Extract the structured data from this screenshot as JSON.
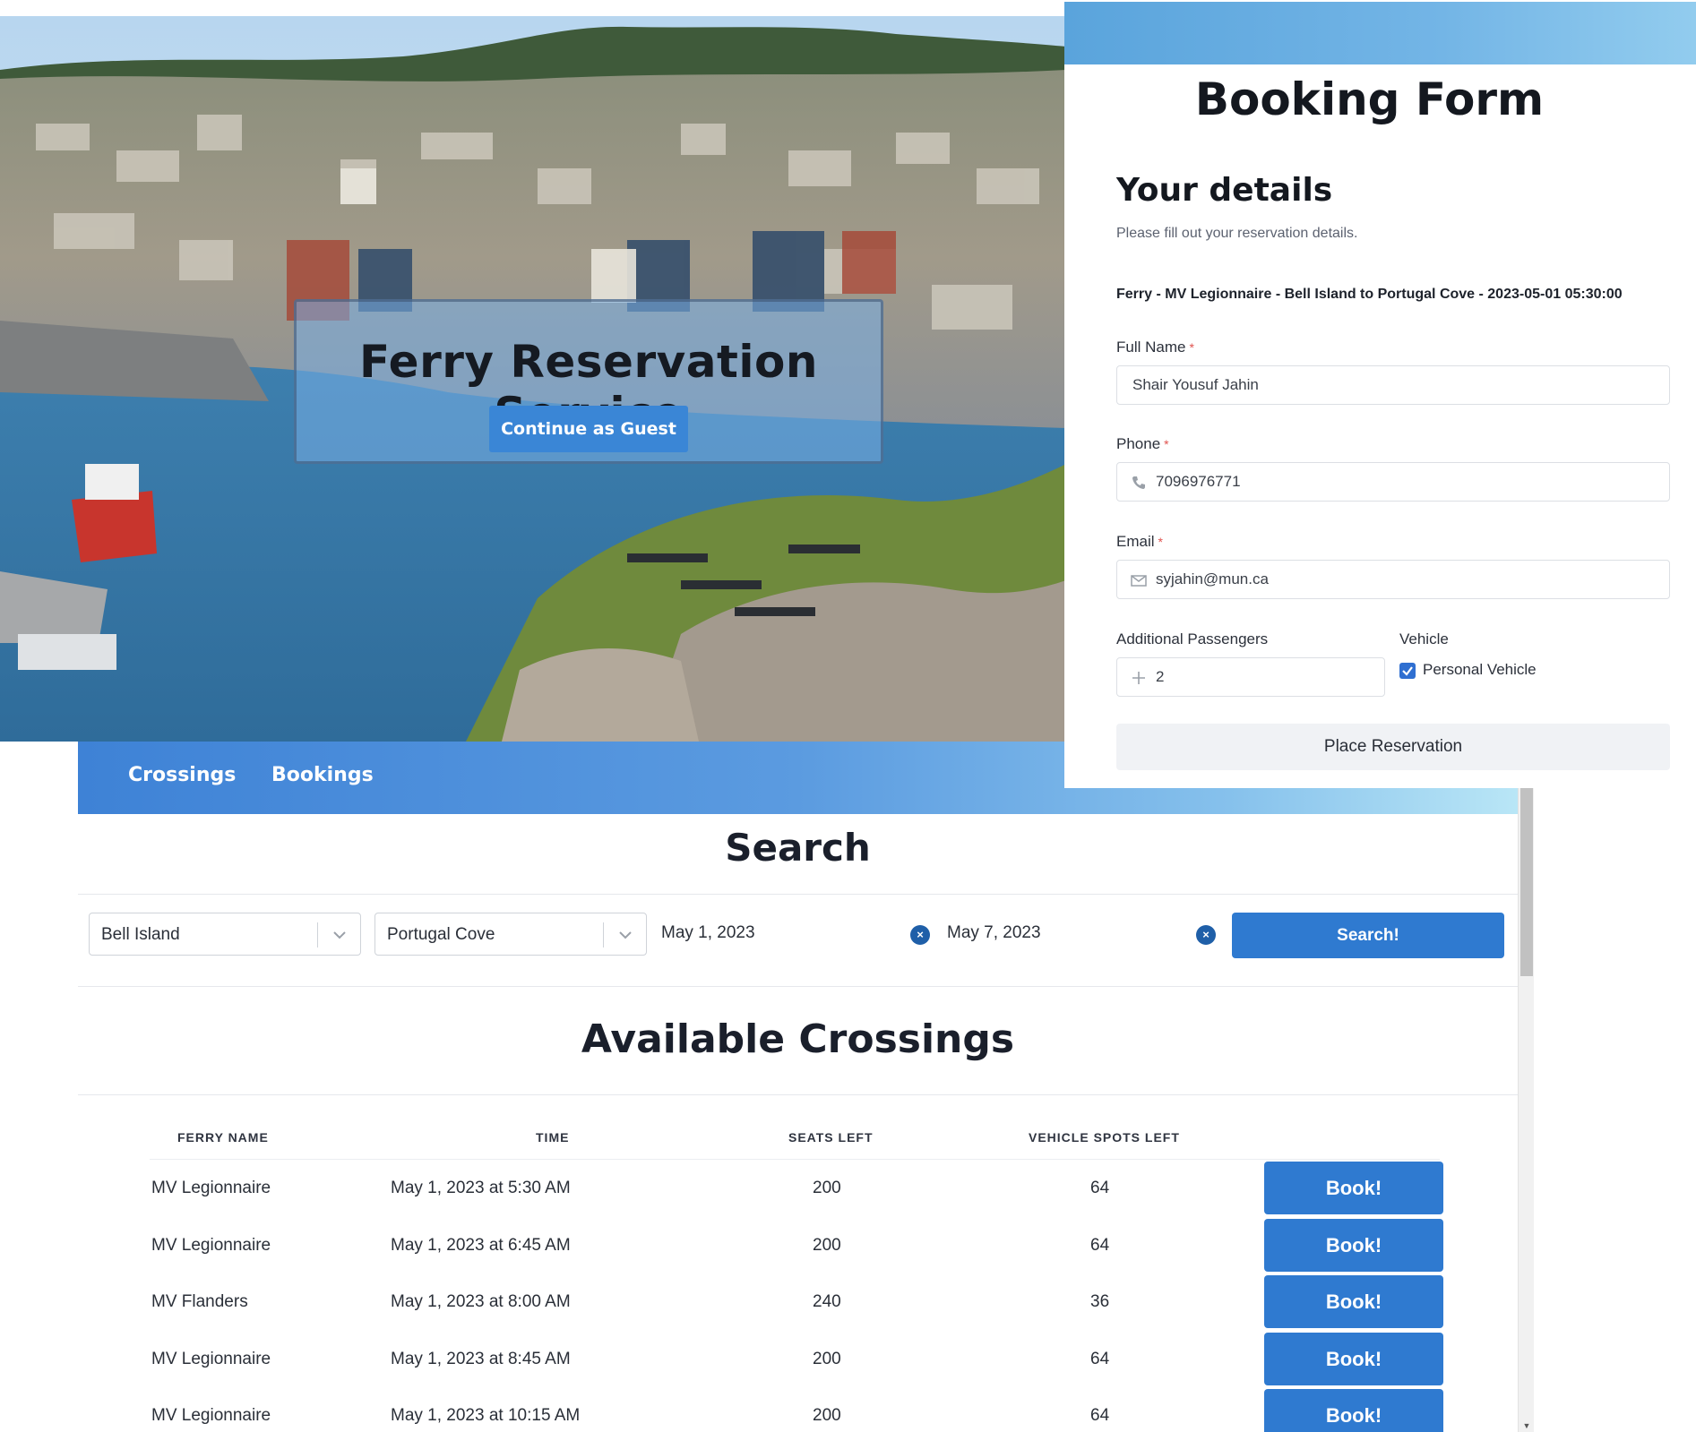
{
  "hero": {
    "title": "Ferry Reservation Service",
    "guest_button": "Continue as Guest"
  },
  "nav": {
    "items": [
      {
        "label": "Crossings"
      },
      {
        "label": "Bookings"
      }
    ]
  },
  "search": {
    "title": "Search",
    "origin": "Bell Island",
    "destination": "Portugal Cove",
    "date_from": "May 1, 2023",
    "date_to": "May 7, 2023",
    "button": "Search!"
  },
  "crossings": {
    "title": "Available Crossings",
    "columns": [
      "Ferry Name",
      "Time",
      "Seats Left",
      "Vehicle Spots Left"
    ],
    "book_label": "Book!",
    "rows": [
      {
        "ferry": "MV Legionnaire",
        "time": "May 1, 2023 at 5:30 AM",
        "seats": "200",
        "vehicles": "64"
      },
      {
        "ferry": "MV Legionnaire",
        "time": "May 1, 2023 at 6:45 AM",
        "seats": "200",
        "vehicles": "64"
      },
      {
        "ferry": "MV Flanders",
        "time": "May 1, 2023 at 8:00 AM",
        "seats": "240",
        "vehicles": "36"
      },
      {
        "ferry": "MV Legionnaire",
        "time": "May 1, 2023 at 8:45 AM",
        "seats": "200",
        "vehicles": "64"
      },
      {
        "ferry": "MV Legionnaire",
        "time": "May 1, 2023 at 10:15 AM",
        "seats": "200",
        "vehicles": "64"
      }
    ]
  },
  "booking_form": {
    "title": "Booking Form",
    "section_title": "Your details",
    "subtitle": "Please fill out your reservation details.",
    "trip": "Ferry - MV Legionnaire - Bell Island to Portugal Cove - 2023-05-01 05:30:00",
    "required_mark": "*",
    "full_name": {
      "label": "Full Name",
      "value": "Shair Yousuf Jahin"
    },
    "phone": {
      "label": "Phone",
      "value": "7096976771"
    },
    "email": {
      "label": "Email",
      "value": "syjahin@mun.ca"
    },
    "passengers": {
      "label": "Additional Passengers",
      "value": "2"
    },
    "vehicle": {
      "label": "Vehicle",
      "option": "Personal Vehicle",
      "checked": true
    },
    "submit": "Place Reservation"
  },
  "colors": {
    "accent": "#2f7ad0",
    "nav_start": "#3e82d6",
    "nav_end": "#b9e6f6",
    "required": "#e0524e"
  },
  "icons": [
    "chevron-down-icon",
    "clear-icon",
    "phone-icon",
    "mail-icon",
    "plus-icon",
    "check-icon"
  ]
}
